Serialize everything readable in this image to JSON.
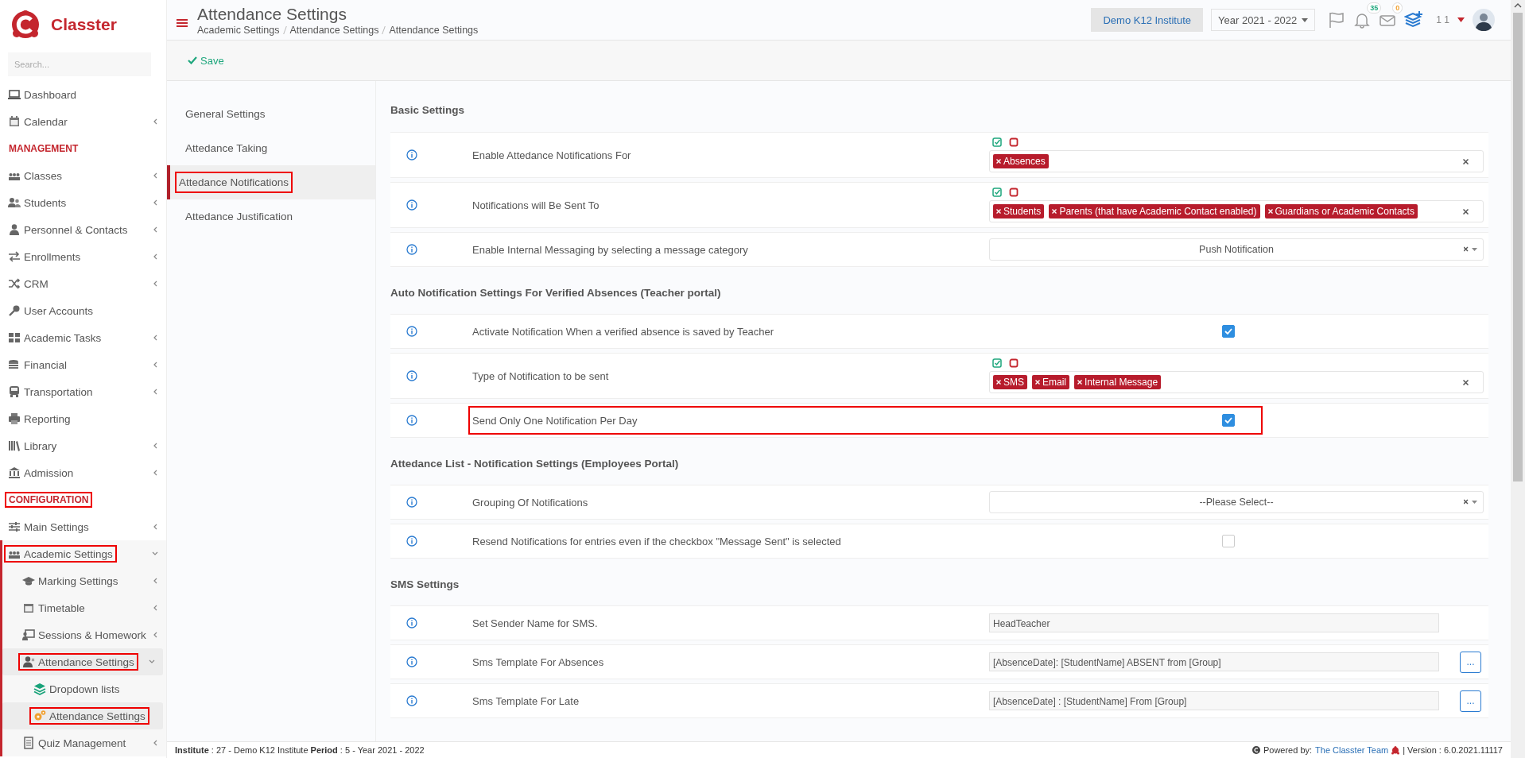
{
  "sidebar": {
    "logo": "Classter",
    "search": {
      "placeholder": "Search..."
    },
    "items": [
      {
        "kind": "item",
        "label": "Dashboard",
        "expandable": false,
        "expanded": false,
        "selected": false,
        "highlighted": false
      },
      {
        "kind": "item",
        "label": "Calendar",
        "expandable": true,
        "expanded": false,
        "selected": false,
        "highlighted": false
      },
      {
        "kind": "heading",
        "label": "MANAGEMENT",
        "highlighted": false
      },
      {
        "kind": "item",
        "label": "Classes",
        "expandable": true,
        "expanded": false,
        "selected": false,
        "highlighted": false
      },
      {
        "kind": "item",
        "label": "Students",
        "expandable": true,
        "expanded": false,
        "selected": false,
        "highlighted": false
      },
      {
        "kind": "item",
        "label": "Personnel & Contacts",
        "expandable": true,
        "expanded": false,
        "selected": false,
        "highlighted": false
      },
      {
        "kind": "item",
        "label": "Enrollments",
        "expandable": true,
        "expanded": false,
        "selected": false,
        "highlighted": false
      },
      {
        "kind": "item",
        "label": "CRM",
        "expandable": true,
        "expanded": false,
        "selected": false,
        "highlighted": false
      },
      {
        "kind": "item",
        "label": "User Accounts",
        "expandable": false,
        "expanded": false,
        "selected": false,
        "highlighted": false
      },
      {
        "kind": "item",
        "label": "Academic Tasks",
        "expandable": true,
        "expanded": false,
        "selected": false,
        "highlighted": false
      },
      {
        "kind": "item",
        "label": "Financial",
        "expandable": true,
        "expanded": false,
        "selected": false,
        "highlighted": false
      },
      {
        "kind": "item",
        "label": "Transportation",
        "expandable": true,
        "expanded": false,
        "selected": false,
        "highlighted": false
      },
      {
        "kind": "item",
        "label": "Reporting",
        "expandable": false,
        "expanded": false,
        "selected": false,
        "highlighted": false
      },
      {
        "kind": "item",
        "label": "Library",
        "expandable": true,
        "expanded": false,
        "selected": false,
        "highlighted": false
      },
      {
        "kind": "item",
        "label": "Admission",
        "expandable": true,
        "expanded": false,
        "selected": false,
        "highlighted": false
      },
      {
        "kind": "heading",
        "label": "CONFIGURATION",
        "highlighted": true
      },
      {
        "kind": "item",
        "label": "Main Settings",
        "expandable": true,
        "expanded": false,
        "selected": false,
        "highlighted": false
      },
      {
        "kind": "item",
        "label": "Academic Settings",
        "expandable": true,
        "expanded": true,
        "selected": false,
        "highlighted": true,
        "children": [
          {
            "label": "Marking Settings",
            "expandable": true,
            "expanded": false,
            "selected": false,
            "highlighted": false
          },
          {
            "label": "Timetable",
            "expandable": true,
            "expanded": false,
            "selected": false,
            "highlighted": false
          },
          {
            "label": "Sessions & Homework",
            "expandable": true,
            "expanded": false,
            "selected": false,
            "highlighted": false
          },
          {
            "label": "Attendance Settings",
            "expandable": true,
            "expanded": true,
            "selected": true,
            "highlighted": true,
            "children": [
              {
                "label": "Dropdown lists",
                "selected": false,
                "highlighted": false
              },
              {
                "label": "Attendance Settings",
                "selected": true,
                "highlighted": true
              }
            ]
          },
          {
            "label": "Quiz Management",
            "expandable": true,
            "expanded": false,
            "selected": false,
            "highlighted": false
          }
        ]
      }
    ]
  },
  "header": {
    "title": "Attendance Settings",
    "breadcrumbs": [
      "Academic Settings",
      "Attendance Settings",
      "Attendance Settings"
    ],
    "institute": "Demo K12 Institute",
    "year": "Year 2021 - 2022",
    "notifications": "35",
    "messages": "0",
    "user": "1 1"
  },
  "toolbar": {
    "save": "Save"
  },
  "tabs": [
    {
      "label": "General Settings",
      "selected": false,
      "highlighted": false
    },
    {
      "label": "Attedance Taking",
      "selected": false,
      "highlighted": false
    },
    {
      "label": "Attedance Notifications",
      "selected": true,
      "highlighted": true
    },
    {
      "label": "Attedance Justification",
      "selected": false,
      "highlighted": false
    }
  ],
  "sections": [
    {
      "heading": "Basic Settings",
      "rows": [
        {
          "kind": "tags",
          "label": "Enable Attedance Notifications For",
          "highlighted": false,
          "tags": [
            "Absences"
          ]
        },
        {
          "kind": "tags",
          "label": "Notifications will Be Sent To",
          "highlighted": false,
          "tags": [
            "Students",
            "Parents (that have Academic Contact enabled)",
            "Guardians or Academic Contacts"
          ]
        },
        {
          "kind": "select",
          "label": "Enable Internal Messaging by selecting a message category",
          "highlighted": false,
          "value": "Push Notification"
        }
      ]
    },
    {
      "heading": "Auto Notification Settings For Verified Absences (Teacher portal)",
      "rows": [
        {
          "kind": "checkbox",
          "label": "Activate Notification When a verified absence is saved by Teacher",
          "highlighted": false,
          "checked": true
        },
        {
          "kind": "tags",
          "label": "Type of Notification to be sent",
          "highlighted": false,
          "tags": [
            "SMS",
            "Email",
            "Internal Message"
          ]
        },
        {
          "kind": "checkbox",
          "label": "Send Only One Notification Per Day",
          "highlighted": true,
          "checked": true
        }
      ]
    },
    {
      "heading": "Attedance List - Notification Settings (Employees Portal)",
      "rows": [
        {
          "kind": "select",
          "label": "Grouping Of Notifications",
          "highlighted": false,
          "value": "--Please Select--"
        },
        {
          "kind": "checkbox",
          "label": "Resend Notifications for entries even if the checkbox \"Message Sent\" is selected",
          "highlighted": false,
          "checked": false
        }
      ]
    },
    {
      "heading": "SMS Settings",
      "rows": [
        {
          "kind": "input",
          "label": "Set Sender Name for SMS.",
          "highlighted": false,
          "value": "HeadTeacher"
        },
        {
          "kind": "template",
          "label": "Sms Template For Absences",
          "highlighted": false,
          "value": "[AbsenceDate]: [StudentName] ABSENT from [Group]",
          "button": "..."
        },
        {
          "kind": "template",
          "label": "Sms Template For Late",
          "highlighted": false,
          "value": "[AbsenceDate] : [StudentName] From [Group]",
          "button": "..."
        }
      ]
    }
  ],
  "footer": {
    "info": "**Institute** : 27 - Demo K12 Institute **Period** : 5 - Year 2021 - 2022",
    "powered": "Powered by:",
    "team": "The Classter Team",
    "version": "| Version : 6.0.2021.11117"
  }
}
